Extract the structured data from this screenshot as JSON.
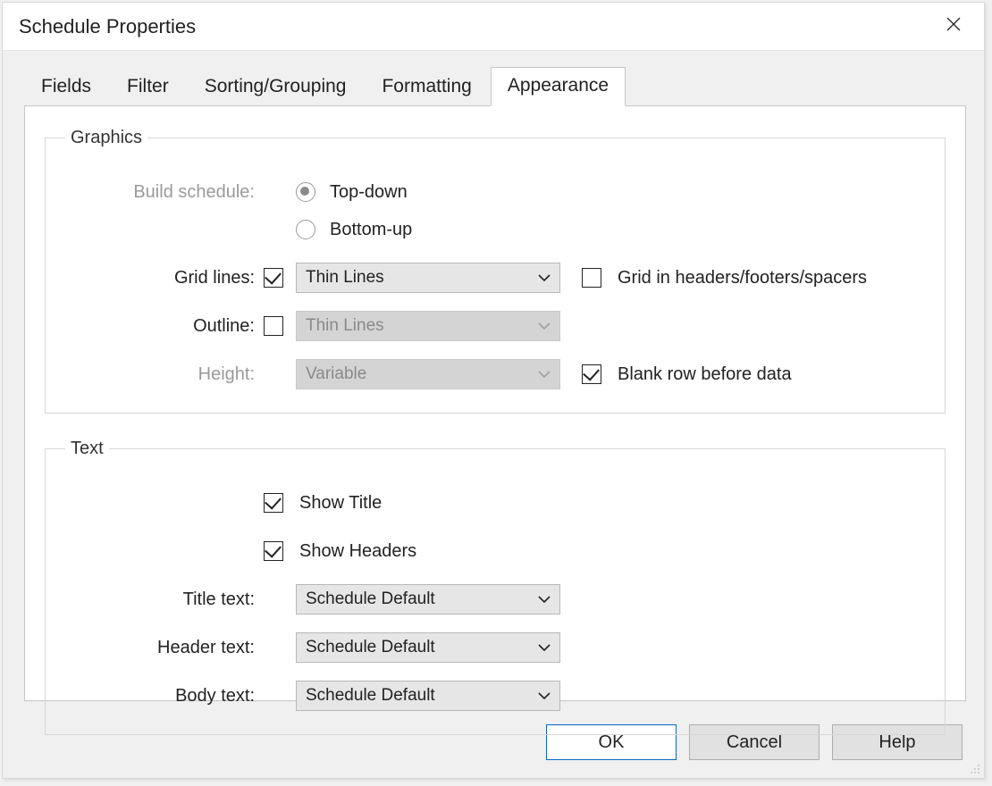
{
  "dialog": {
    "title": "Schedule Properties"
  },
  "tabs": {
    "t0": "Fields",
    "t1": "Filter",
    "t2": "Sorting/Grouping",
    "t3": "Formatting",
    "t4": "Appearance",
    "active_index": 4
  },
  "graphics": {
    "legend": "Graphics",
    "build_schedule_label": "Build schedule:",
    "build_top_down": "Top-down",
    "build_bottom_up": "Bottom-up",
    "build_selected": "top-down",
    "grid_lines_label": "Grid lines:",
    "grid_lines_checked": true,
    "grid_lines_style": "Thin Lines",
    "grid_headers_label": "Grid in headers/footers/spacers",
    "grid_headers_checked": false,
    "outline_label": "Outline:",
    "outline_checked": false,
    "outline_style": "Thin Lines",
    "height_label": "Height:",
    "height_value": "Variable",
    "blank_row_label": "Blank row before data",
    "blank_row_checked": true
  },
  "text": {
    "legend": "Text",
    "show_title_label": "Show Title",
    "show_title_checked": true,
    "show_headers_label": "Show Headers",
    "show_headers_checked": true,
    "title_text_label": "Title text:",
    "title_text_value": "Schedule Default",
    "header_text_label": "Header text:",
    "header_text_value": "Schedule Default",
    "body_text_label": "Body text:",
    "body_text_value": "Schedule Default"
  },
  "buttons": {
    "ok": "OK",
    "cancel": "Cancel",
    "help": "Help"
  }
}
